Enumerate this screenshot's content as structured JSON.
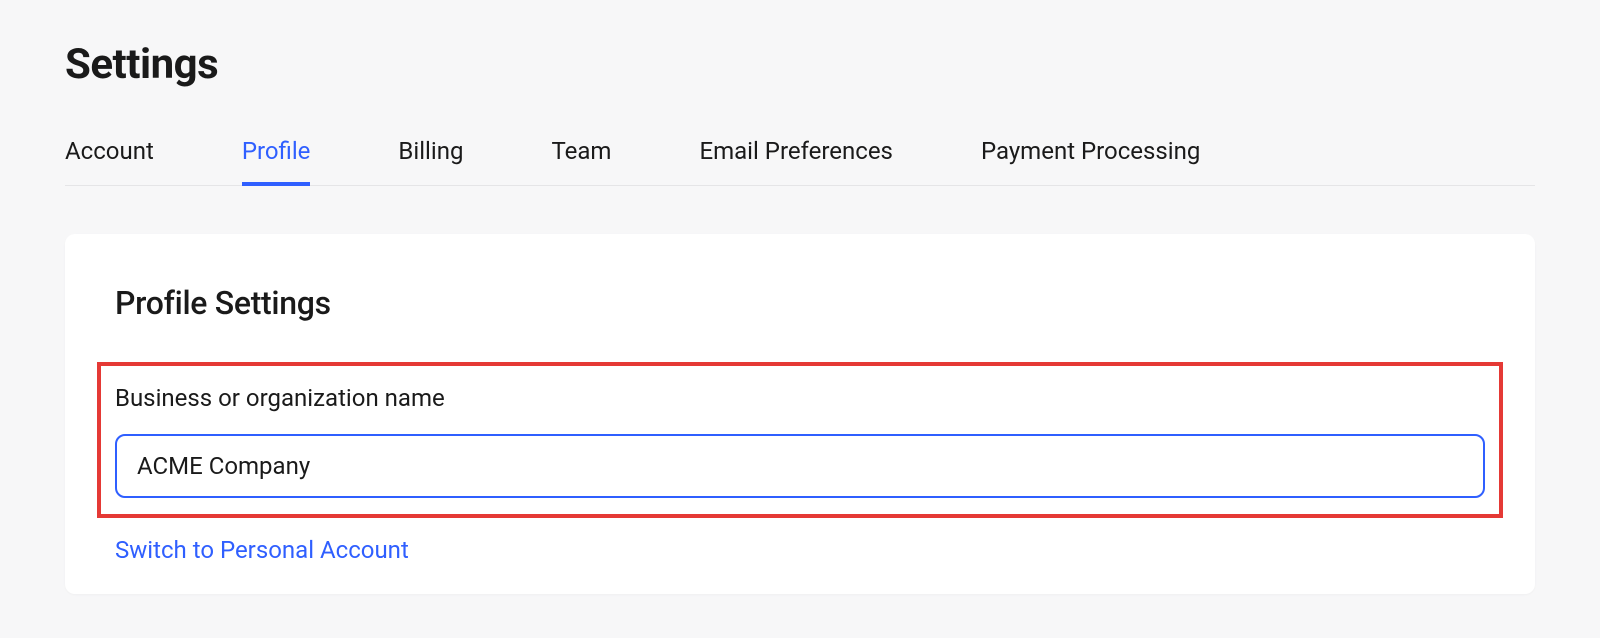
{
  "page": {
    "title": "Settings"
  },
  "tabs": {
    "items": [
      {
        "label": "Account",
        "active": false
      },
      {
        "label": "Profile",
        "active": true
      },
      {
        "label": "Billing",
        "active": false
      },
      {
        "label": "Team",
        "active": false
      },
      {
        "label": "Email Preferences",
        "active": false
      },
      {
        "label": "Payment Processing",
        "active": false
      }
    ]
  },
  "profile": {
    "card_title": "Profile Settings",
    "org_name_label": "Business or organization name",
    "org_name_value": "ACME Company",
    "switch_link": "Switch to Personal Account"
  },
  "colors": {
    "accent": "#2f5fff",
    "highlight_border": "#e53935",
    "background": "#f7f7f8",
    "text": "#1a1a1a"
  }
}
